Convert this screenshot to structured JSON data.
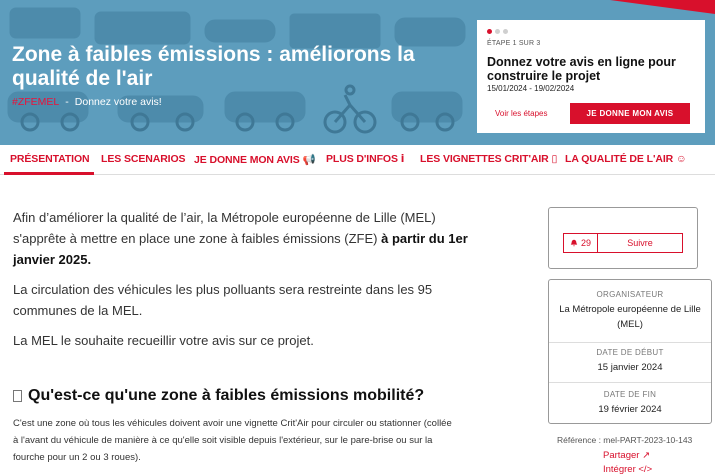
{
  "hero": {
    "title": "Zone à faibles émissions : améliorons la qualité de l'air",
    "hashtag": "#ZFEMEL",
    "separator": "-",
    "subtitle": "Donnez votre avis!",
    "background_color": "#5d9dbd",
    "accent_color": "#d8102c"
  },
  "step_card": {
    "step": "ÉTAPE 1 SUR 3",
    "title": "Donnez votre avis en ligne pour construire le projet",
    "dates": "15/01/2024 - 19/02/2024",
    "steps_link": "Voir les étapes",
    "cta": "JE DONNE MON AVIS"
  },
  "nav": {
    "items": [
      {
        "label": "PRÉSENTATION",
        "active": true
      },
      {
        "label": "LES SCENARIOS"
      },
      {
        "label": "JE DONNE MON AVIS",
        "icon": "megaphone-icon"
      },
      {
        "label": "PLUS D'INFOS",
        "icon": "info-icon"
      },
      {
        "label": "LES VIGNETTES CRIT'AIR",
        "icon": "document-icon"
      },
      {
        "label": "LA QUALITÉ DE L'AIR",
        "icon": "smiley-icon"
      }
    ]
  },
  "main": {
    "p1_start": "Afin d’améliorer la qualité de l’air, la Métropole européenne de Lille (MEL) s'apprête à mettre en place une zone à faibles émissions (ZFE)",
    "p1_bold": "à partir du 1er janvier 2025.",
    "p2": "La circulation des véhicules les plus polluants sera restreinte dans les 95 communes de la MEL.",
    "p3": "La MEL le souhaite recueillir votre avis sur ce projet.",
    "heading": "Qu'est-ce qu'une zone à faibles émissions mobilité?",
    "small_text": "C'est une zone où tous les véhicules doivent avoir une vignette Crit'Air pour circuler ou stationner (collée à l'avant du véhicule de manière à ce qu'elle soit visible depuis l'extérieur, sur le pare-brise ou sur la fourche pour un 2 ou 3 roues)."
  },
  "sidebar": {
    "follow_count": "29",
    "follow_label": "Suivre",
    "organizer_label": "ORGANISATEUR",
    "organizer": "La Métropole européenne de Lille (MEL)",
    "start_label": "DATE DE DÉBUT",
    "start": "15 janvier 2024",
    "end_label": "DATE DE FIN",
    "end": "19 février 2024",
    "reference": "Référence : mel-PART-2023-10-143",
    "share": "Partager ↗",
    "embed": "Intégrer </>"
  }
}
